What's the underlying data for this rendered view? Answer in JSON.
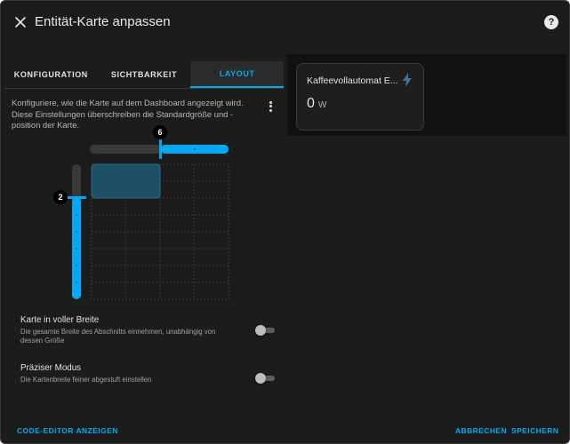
{
  "dialog": {
    "title": "Entität-Karte anpassen",
    "help_label": "?"
  },
  "tabs": [
    {
      "label": "KONFIGURATION",
      "active": false
    },
    {
      "label": "SICHTBARKEIT",
      "active": false
    },
    {
      "label": "LAYOUT",
      "active": true
    }
  ],
  "layout": {
    "description": "Konfiguriere, wie die Karte auf dem Dashboard angezeigt wird. Diese Einstellungen überschreiben die Standardgröße und -position der Karte.",
    "width_value": "6",
    "height_value": "2",
    "grid_columns": 4,
    "grid_rows": 8,
    "selected_columns": 2,
    "selected_rows": 2
  },
  "preview": {
    "card_name": "Kaffeevollautomat E...",
    "value": "0",
    "unit": "W",
    "icon": "flash-icon"
  },
  "options": [
    {
      "title": "Karte in voller Breite",
      "description": "Die gesamte Breite des Abschnitts einnehmen, unabhängig von dessen Größe",
      "enabled": false
    },
    {
      "title": "Präziser Modus",
      "description": "Die Kartenbreite feiner abgestuft einstellen",
      "enabled": false
    }
  ],
  "footer": {
    "code_editor_label": "CODE-EDITOR ANZEIGEN",
    "cancel_label": "ABBRECHEN",
    "save_label": "SPEICHERN"
  },
  "colors": {
    "accent": "#03a9f4",
    "background": "#1c1c1c",
    "preview_background": "#111111"
  }
}
